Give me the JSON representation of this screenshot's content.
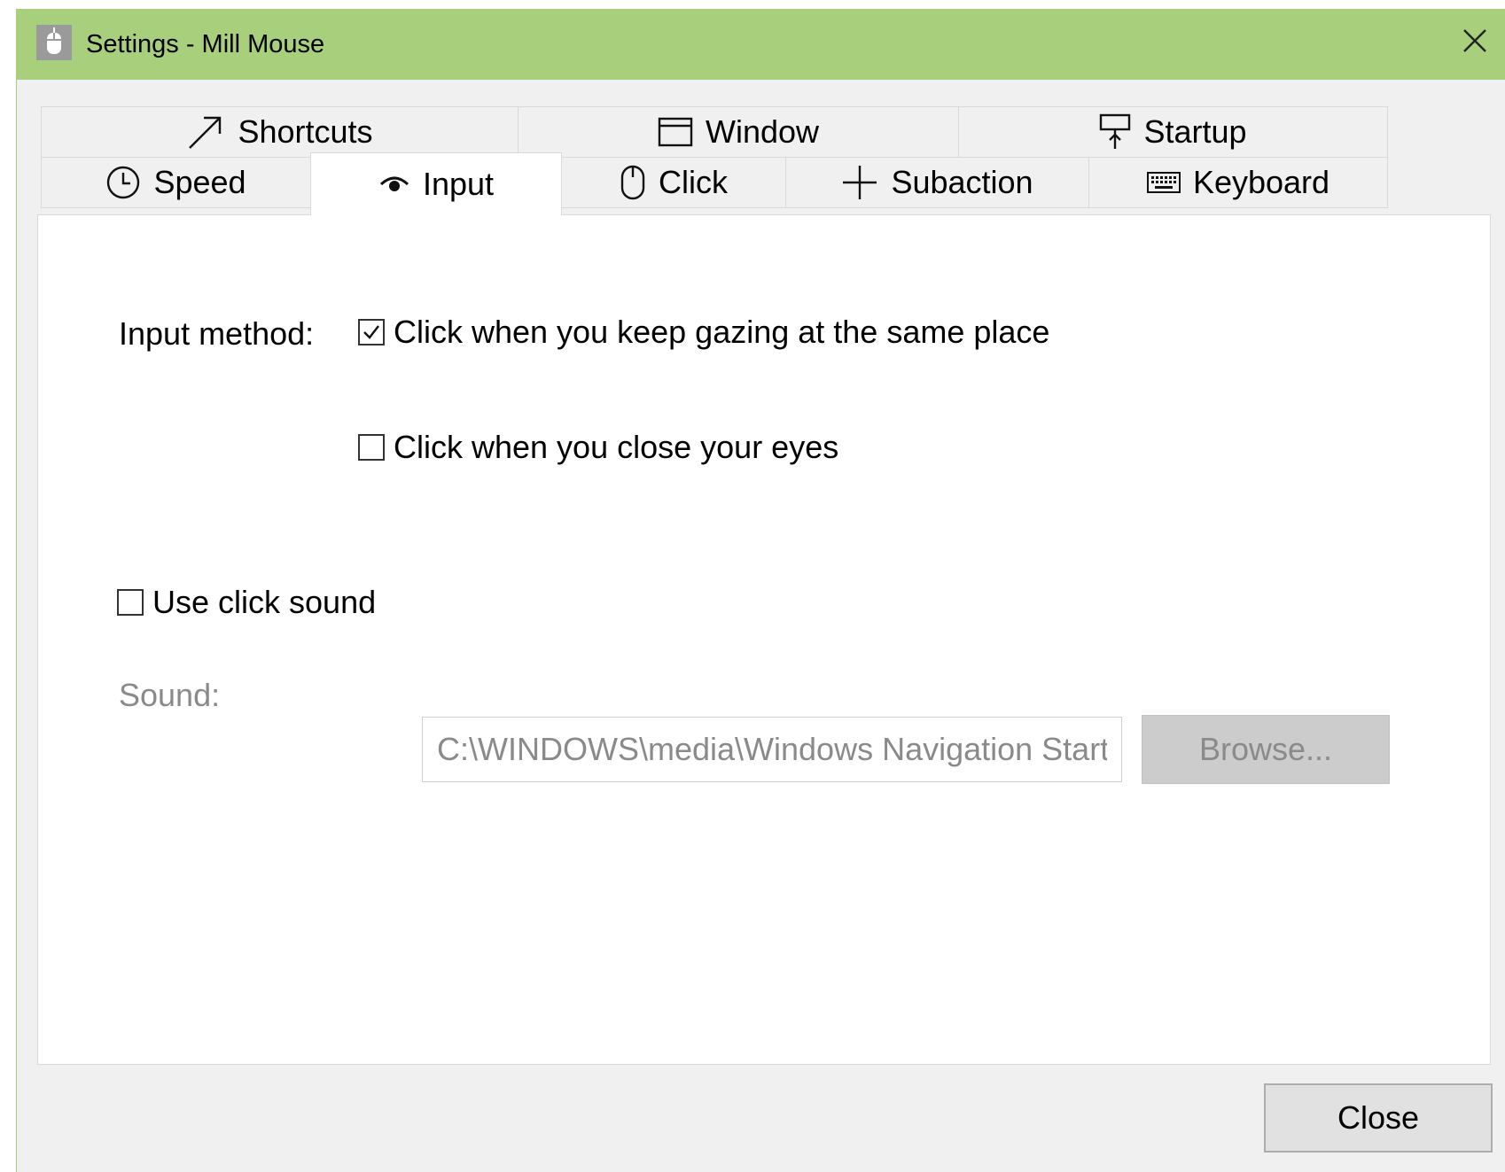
{
  "window": {
    "title": "Settings - Mill Mouse",
    "accent_color": "#a8cf7c"
  },
  "tabs": {
    "row1": [
      {
        "label": "Shortcuts",
        "icon": "arrow-up-right-icon"
      },
      {
        "label": "Window",
        "icon": "window-icon"
      },
      {
        "label": "Startup",
        "icon": "startup-icon"
      }
    ],
    "row2": [
      {
        "label": "Speed",
        "icon": "clock-icon"
      },
      {
        "label": "Input",
        "icon": "eye-icon",
        "active": true
      },
      {
        "label": "Click",
        "icon": "mouse-icon"
      },
      {
        "label": "Subaction",
        "icon": "plus-icon"
      },
      {
        "label": "Keyboard",
        "icon": "keyboard-icon"
      }
    ]
  },
  "input_panel": {
    "input_method_label": "Input method:",
    "options": [
      {
        "label": "Click when you keep gazing at the same place",
        "checked": true
      },
      {
        "label": "Click when you close your eyes",
        "checked": false
      }
    ],
    "click_sound": {
      "label": "Use click sound",
      "checked": false
    },
    "sound_label": "Sound:",
    "sound_path": "C:\\WINDOWS\\media\\Windows Navigation Start.wav",
    "browse_label": "Browse..."
  },
  "footer": {
    "close_label": "Close"
  }
}
